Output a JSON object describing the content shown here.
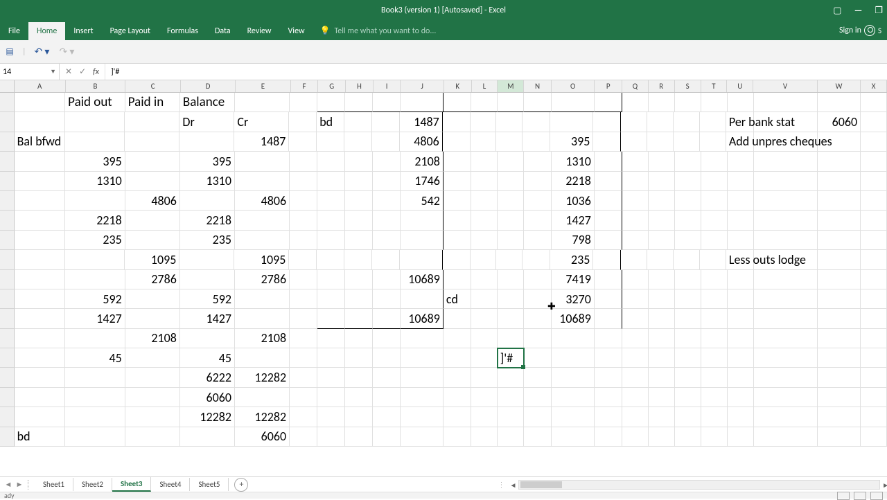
{
  "app": {
    "title": "Book3 (version 1) [Autosaved] - Excel"
  },
  "ribbon": {
    "tabs": [
      "File",
      "Home",
      "Insert",
      "Page Layout",
      "Formulas",
      "Data",
      "Review",
      "View"
    ],
    "tell_me": "Tell me what you want to do...",
    "signin": "Sign in"
  },
  "namebox": "14",
  "formula": "]'#",
  "columns": [
    "A",
    "B",
    "C",
    "D",
    "E",
    "F",
    "G",
    "H",
    "I",
    "J",
    "K",
    "L",
    "M",
    "N",
    "O",
    "P",
    "Q",
    "R",
    "S",
    "T",
    "U",
    "V",
    "W",
    "X"
  ],
  "active_col": "M",
  "sheets": {
    "items": [
      "Sheet1",
      "Sheet2",
      "Sheet3",
      "Sheet4",
      "Sheet5"
    ],
    "active": "Sheet3"
  },
  "status": "ady",
  "cells": {
    "r1": {
      "B": "Paid out",
      "C": "Paid in",
      "D": "Balance"
    },
    "r2": {
      "D": "Dr",
      "E": "Cr",
      "G": "bd",
      "J": "1487",
      "U": "Per bank stat",
      "W": "6060"
    },
    "r3": {
      "A": "Bal bfwd",
      "E": "1487",
      "J": "4806",
      "O": "395",
      "U": "Add unpres cheques"
    },
    "r4": {
      "B": "395",
      "D": "395",
      "J": "2108",
      "O": "1310"
    },
    "r5": {
      "B": "1310",
      "D": "1310",
      "J": "1746",
      "O": "2218"
    },
    "r6": {
      "C": "4806",
      "E": "4806",
      "J": "542",
      "O": "1036"
    },
    "r7": {
      "B": "2218",
      "D": "2218",
      "O": "1427"
    },
    "r8": {
      "B": "235",
      "D": "235",
      "O": "798"
    },
    "r9": {
      "C": "1095",
      "E": "1095",
      "O": "235",
      "U": "Less outs lodge"
    },
    "r10": {
      "C": "2786",
      "E": "2786",
      "J": "10689",
      "O": "7419"
    },
    "r11": {
      "B": "592",
      "D": "592",
      "K": "cd",
      "O": "3270"
    },
    "r12": {
      "B": "1427",
      "D": "1427",
      "J": "10689",
      "O": "10689"
    },
    "r13": {
      "C": "2108",
      "E": "2108"
    },
    "r14": {
      "B": "45",
      "D": "45",
      "M": "]'#"
    },
    "r15": {
      "D": "6222",
      "E": "12282"
    },
    "r16": {
      "D": "6060"
    },
    "r17": {
      "D": "12282",
      "E": "12282"
    },
    "r18": {
      "A": "bd",
      "E": "6060"
    }
  },
  "chart_data": null
}
